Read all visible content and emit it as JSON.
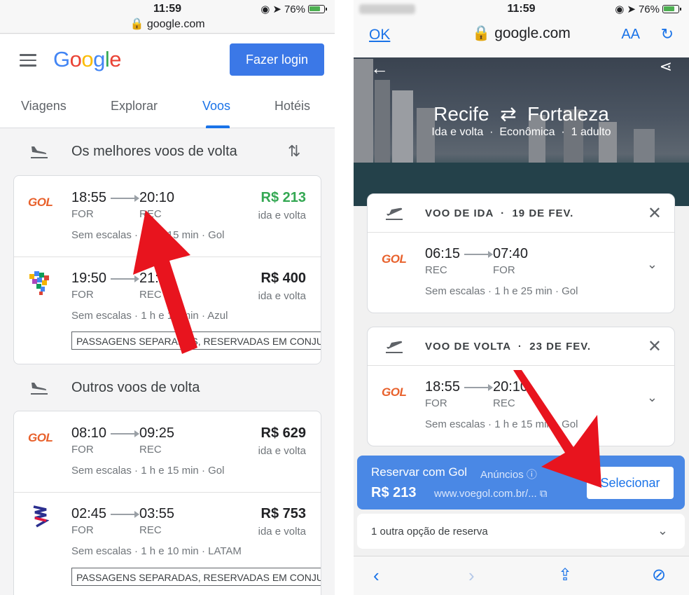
{
  "left": {
    "status": {
      "time": "11:59",
      "url": "google.com",
      "battery": "76%"
    },
    "header": {
      "logo": "Google",
      "login_label": "Fazer login"
    },
    "tabs": [
      "Viagens",
      "Explorar",
      "Voos",
      "Hotéis"
    ],
    "active_tab": "Voos",
    "best_section": "Os melhores voos de volta",
    "other_section": "Outros voos de volta",
    "best_flights": [
      {
        "airline_logo": "GOL",
        "dep": "18:55",
        "arr": "20:10",
        "from": "FOR",
        "to": "REC",
        "stops": "Sem escalas",
        "duration": "1 h e 15 min",
        "airline": "Gol",
        "price": "R$ 213",
        "price_sub": "ida e volta",
        "highlight": true
      },
      {
        "airline_logo": "azul",
        "dep": "19:50",
        "arr": "21:05",
        "from": "FOR",
        "to": "REC",
        "stops": "Sem escalas",
        "duration": "1 h e 15 min",
        "airline": "Azul",
        "price": "R$ 400",
        "price_sub": "ida e volta",
        "note": "PASSAGENS SEPARADAS, RESERVADAS EM CONJU"
      }
    ],
    "other_flights": [
      {
        "airline_logo": "GOL",
        "dep": "08:10",
        "arr": "09:25",
        "from": "FOR",
        "to": "REC",
        "stops": "Sem escalas",
        "duration": "1 h e 15 min",
        "airline": "Gol",
        "price": "R$ 629",
        "price_sub": "ida e volta"
      },
      {
        "airline_logo": "latam",
        "dep": "02:45",
        "arr": "03:55",
        "from": "FOR",
        "to": "REC",
        "stops": "Sem escalas",
        "duration": "1 h e 10 min",
        "airline": "LATAM",
        "price": "R$ 753",
        "price_sub": "ida e volta",
        "note": "PASSAGENS SEPARADAS, RESERVADAS EM CONJU"
      }
    ]
  },
  "right": {
    "status": {
      "time": "11:59",
      "battery": "76%"
    },
    "nav": {
      "ok": "OK",
      "url": "google.com",
      "text_size": "AA"
    },
    "hero": {
      "origin": "Recife",
      "destination": "Fortaleza",
      "trip": "Ida e volta",
      "cabin": "Econômica",
      "passengers": "1 adulto"
    },
    "outbound": {
      "label": "VOO DE IDA",
      "date": "19 DE FEV.",
      "dep": "06:15",
      "arr": "07:40",
      "from": "REC",
      "to": "FOR",
      "stops": "Sem escalas",
      "duration": "1 h e 25 min",
      "airline": "Gol"
    },
    "return": {
      "label": "VOO DE VOLTA",
      "date": "23 DE FEV.",
      "dep": "18:55",
      "arr": "20:10",
      "from": "FOR",
      "to": "REC",
      "stops": "Sem escalas",
      "duration": "1 h e 15 min",
      "airline": "Gol"
    },
    "booking": {
      "title": "Reservar com Gol",
      "ads": "Anúncios",
      "price": "R$ 213",
      "url": "www.voegol.com.br/...",
      "select_label": "Selecionar"
    },
    "other_option": "1 outra opção de reserva"
  },
  "colors": {
    "accent": "#1a73e8",
    "price_green": "#34a853",
    "gol_orange": "#e8612c",
    "arrow_red": "#e8141e"
  }
}
